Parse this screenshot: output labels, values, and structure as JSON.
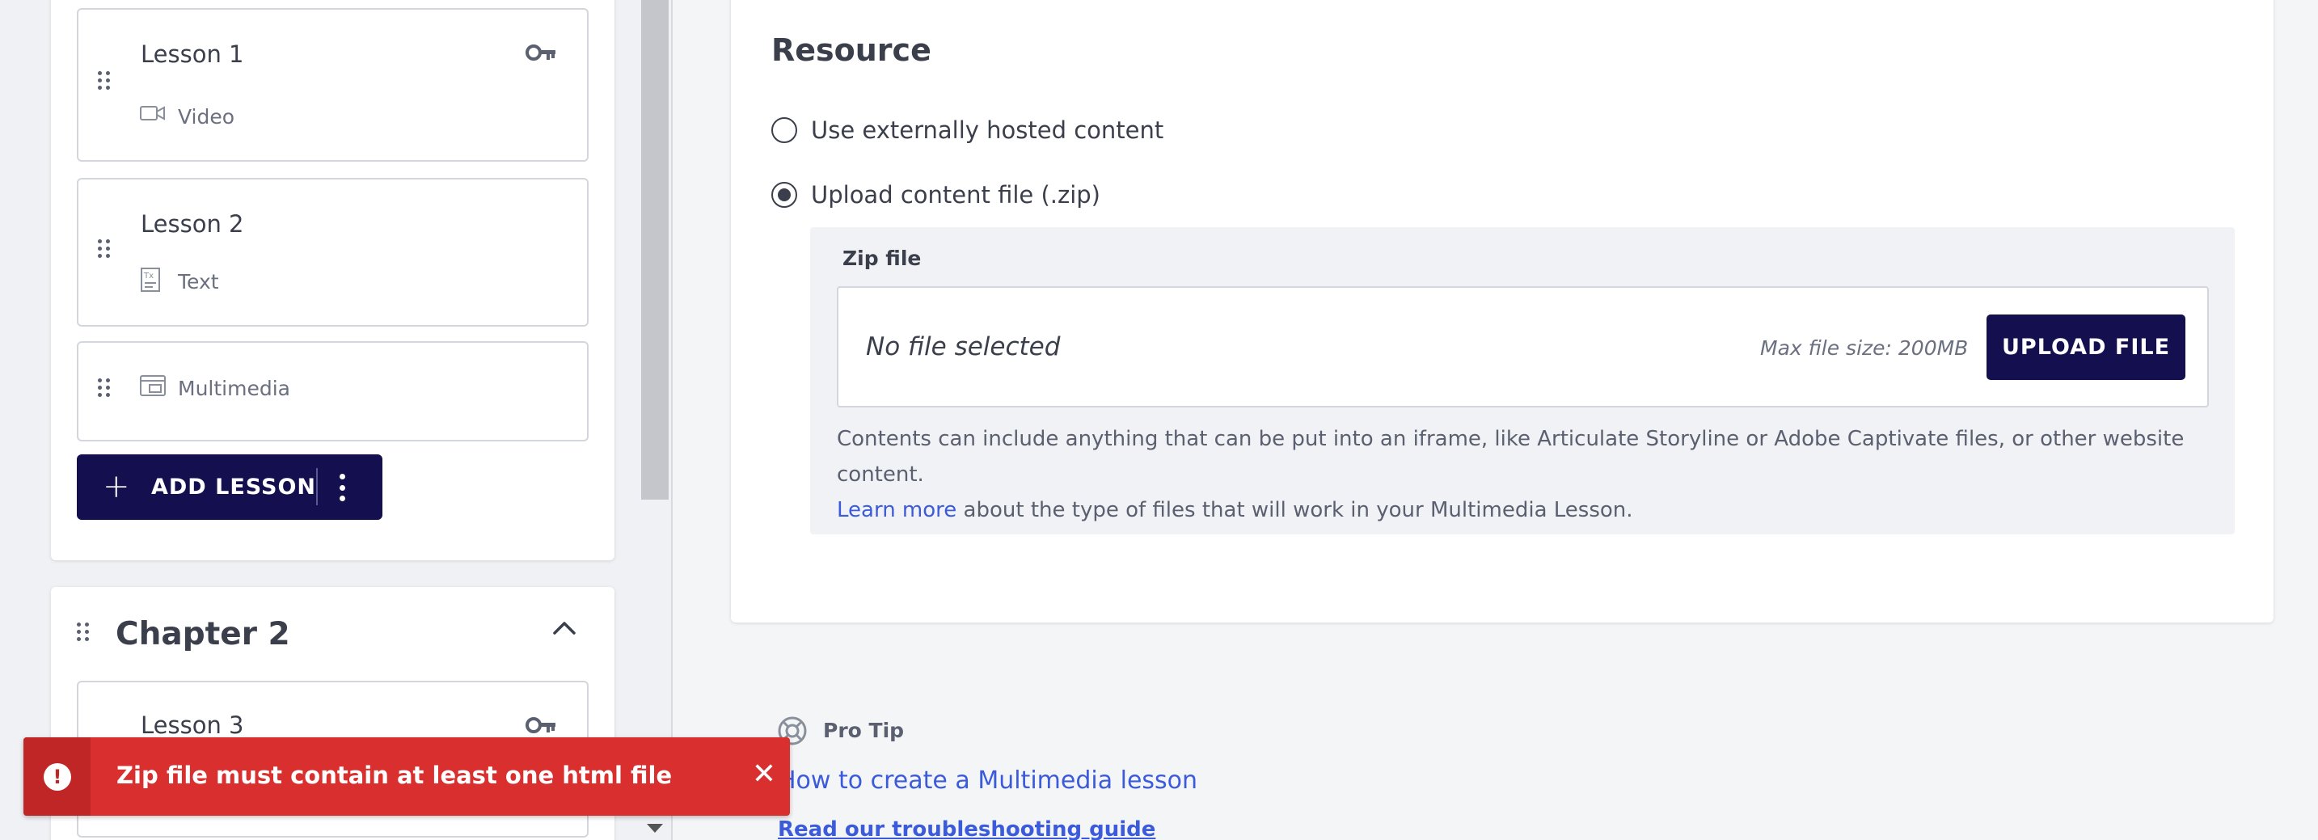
{
  "sidebar": {
    "chapter1": {
      "lessons": [
        {
          "title": "Lesson 1",
          "type": "Video",
          "type_icon": "video-camera-icon",
          "locked_icon": "key-icon"
        },
        {
          "title": "Lesson 2",
          "type": "Text",
          "type_icon": "text-document-icon"
        },
        {
          "title": "",
          "type": "Multimedia",
          "type_icon": "multimedia-icon"
        }
      ],
      "add_lesson_label": "ADD LESSON"
    },
    "chapter2": {
      "title": "Chapter 2",
      "lessons": [
        {
          "title": "Lesson 3",
          "locked_icon": "key-icon"
        }
      ]
    }
  },
  "main": {
    "resource_heading": "Resource",
    "options": [
      {
        "label": "Use externally hosted content",
        "checked": false
      },
      {
        "label": "Upload content file (.zip)",
        "checked": true
      }
    ],
    "zip_field_label": "Zip file",
    "file_status": "No file selected",
    "max_file_size": "Max file size: 200MB",
    "upload_button": "UPLOAD FILE",
    "help_text_line1": "Contents can include anything that can be put into an iframe, like Articulate Storyline or Adobe Captivate files, or other website content.",
    "learn_more": "Learn more",
    "help_text_line2": " about the type of files that will work in your Multimedia Lesson."
  },
  "pro_tip": {
    "label": "Pro Tip",
    "link": "How to create a Multimedia lesson",
    "troubleshoot": "Read our troubleshooting guide"
  },
  "toast": {
    "message": "Zip file must contain at least one html file",
    "close_symbol": "✕",
    "alert_symbol": "!"
  },
  "colors": {
    "primary": "#14104f",
    "error": "#d92f2f",
    "link": "#3b5bdb"
  }
}
